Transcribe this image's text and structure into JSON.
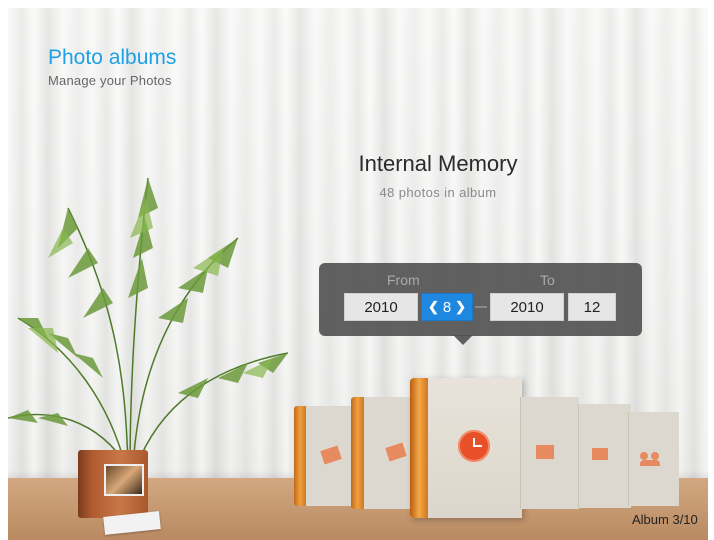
{
  "header": {
    "title": "Photo albums",
    "subtitle": "Manage your Photos"
  },
  "album": {
    "name": "Internal Memory",
    "photo_count_text": "48  photos in album"
  },
  "date_range": {
    "from_label": "From",
    "to_label": "To",
    "from_year": "2010",
    "from_month": "8",
    "to_year": "2010",
    "to_month": "12"
  },
  "carousel": {
    "position_text": "Album 3/10",
    "albums": [
      {
        "icon": "photo-tag-icon"
      },
      {
        "icon": "photo-tag-icon"
      },
      {
        "icon": "clock-icon",
        "selected": true
      },
      {
        "icon": "photo-star-icon"
      },
      {
        "icon": "photo-question-icon"
      },
      {
        "icon": "people-icon"
      }
    ]
  },
  "colors": {
    "accent": "#1ea0e6",
    "selected_field": "#1e88e0",
    "book_spine": "#e8902a",
    "clock_badge": "#e8502a"
  }
}
